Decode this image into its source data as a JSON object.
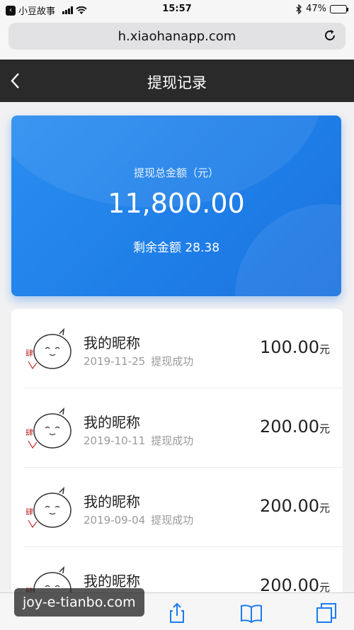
{
  "status_bar": {
    "carrier": "小豆故事",
    "time": "15:57",
    "battery": "47%",
    "battery_level": 0.47
  },
  "browser": {
    "url": "h.xiaohanapp.com"
  },
  "nav": {
    "title": "提现记录"
  },
  "summary": {
    "label": "提现总金额（元）",
    "total": "11,800.00",
    "remaining_label": "剩余金额",
    "remaining_value": "28.38"
  },
  "records": [
    {
      "name": "我的昵称",
      "date": "2019-11-25",
      "status": "提现成功",
      "amount": "100.00",
      "unit": "元"
    },
    {
      "name": "我的昵称",
      "date": "2019-10-11",
      "status": "提现成功",
      "amount": "200.00",
      "unit": "元"
    },
    {
      "name": "我的昵称",
      "date": "2019-09-04",
      "status": "提现成功",
      "amount": "200.00",
      "unit": "元"
    },
    {
      "name": "我的昵称",
      "date": "",
      "status": "",
      "amount": "200.00",
      "unit": "元"
    }
  ],
  "watermark": {
    "text": "joy-e-tianbo.com"
  },
  "colors": {
    "card_blue": "#1f7fe8",
    "nav_dark": "#2a2a2a",
    "battery_green": "#2dbe4f"
  }
}
